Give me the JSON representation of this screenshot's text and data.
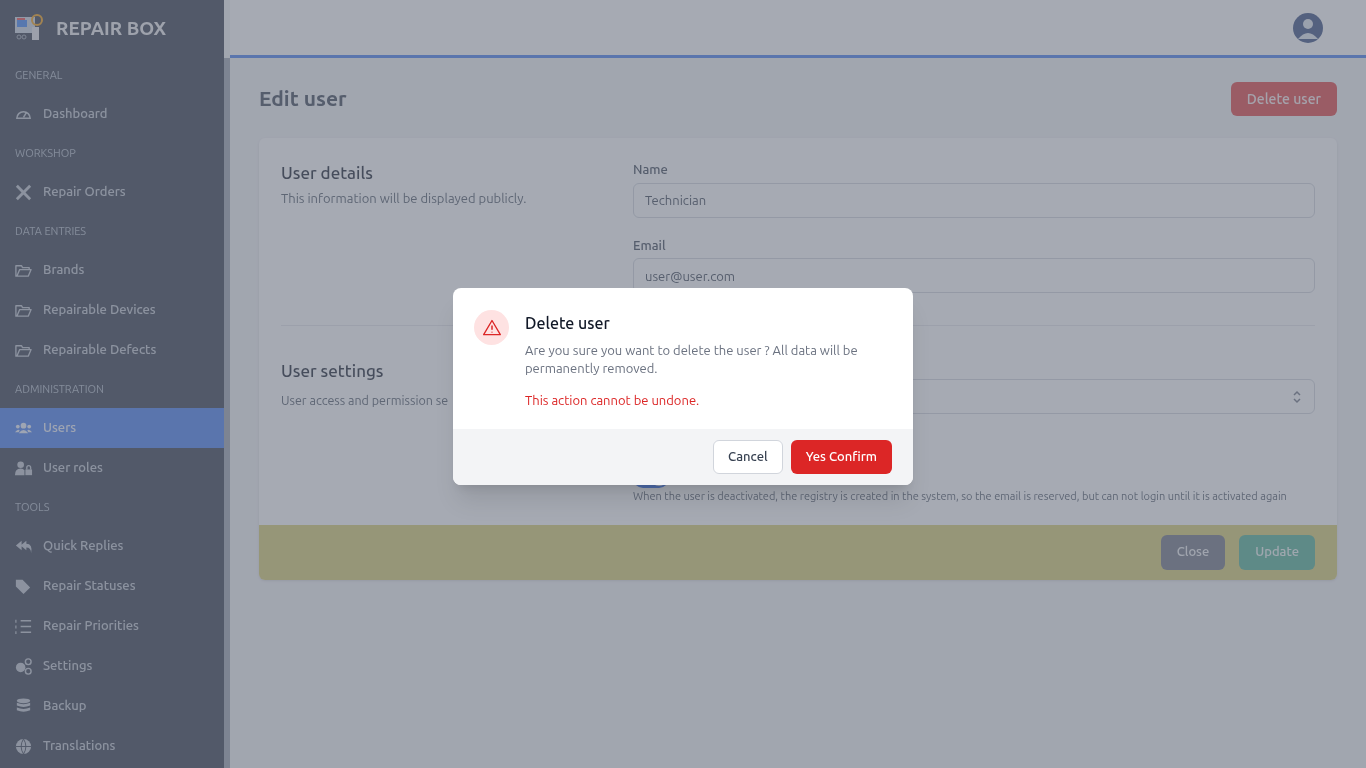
{
  "app": {
    "name": "REPAIR BOX"
  },
  "sidebar": {
    "sections": [
      {
        "heading": "GENERAL",
        "items": [
          {
            "label": "Dashboard",
            "selected": false
          }
        ]
      },
      {
        "heading": "WORKSHOP",
        "items": [
          {
            "label": "Repair Orders",
            "selected": false
          }
        ]
      },
      {
        "heading": "DATA ENTRIES",
        "items": [
          {
            "label": "Brands",
            "selected": false
          },
          {
            "label": "Repairable Devices",
            "selected": false
          },
          {
            "label": "Repairable Defects",
            "selected": false
          }
        ]
      },
      {
        "heading": "ADMINISTRATION",
        "items": [
          {
            "label": "Users",
            "selected": true
          },
          {
            "label": "User roles",
            "selected": false
          }
        ]
      },
      {
        "heading": "TOOLS",
        "items": [
          {
            "label": "Quick Replies",
            "selected": false
          },
          {
            "label": "Repair Statuses",
            "selected": false
          },
          {
            "label": "Repair Priorities",
            "selected": false
          },
          {
            "label": "Settings",
            "selected": false
          },
          {
            "label": "Backup",
            "selected": false
          },
          {
            "label": "Translations",
            "selected": false
          }
        ]
      }
    ]
  },
  "page": {
    "title": "Edit user",
    "delete_button": "Delete user"
  },
  "form": {
    "details": {
      "title": "User details",
      "description": "This information will be displayed publicly.",
      "fields": [
        {
          "label": "Name",
          "value": "Technician"
        },
        {
          "label": "Email",
          "value": "user@user.com"
        }
      ]
    },
    "settings": {
      "title": "User settings",
      "description": "User access and permission se",
      "active_toggle": {
        "on": true,
        "help": "When the user is deactivated, the registry is created in the system, so the email is reserved, but can not login until it is activated again"
      }
    },
    "buttons": [
      "Close",
      "Update"
    ]
  },
  "modal": {
    "title": "Delete user",
    "message": "Are you sure you want to delete the user ? All data will be permanently removed.",
    "warning": "This action cannot be undone.",
    "cancel": "Cancel",
    "confirm": "Yes Confirm"
  }
}
